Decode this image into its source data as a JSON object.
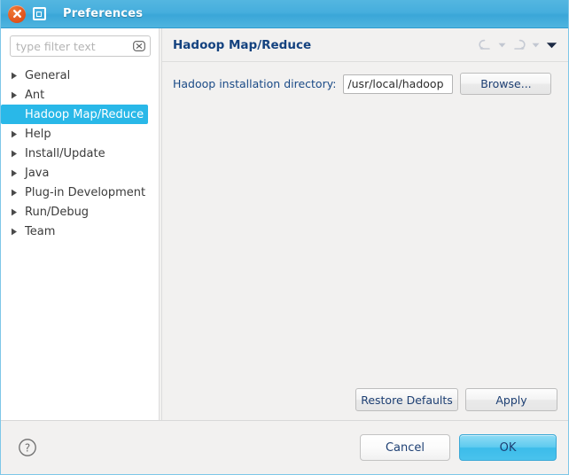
{
  "window": {
    "title": "Preferences",
    "close_icon": "close-icon",
    "maximize_icon": "maximize-icon",
    "titlebar_color": "#46aedd"
  },
  "sidebar": {
    "filter": {
      "placeholder": "type filter text",
      "value": "",
      "clear_icon": "clear-icon"
    },
    "items": [
      {
        "label": "General",
        "expandable": true,
        "selected": false
      },
      {
        "label": "Ant",
        "expandable": true,
        "selected": false
      },
      {
        "label": "Hadoop Map/Reduce",
        "expandable": false,
        "selected": true
      },
      {
        "label": "Help",
        "expandable": true,
        "selected": false
      },
      {
        "label": "Install/Update",
        "expandable": true,
        "selected": false
      },
      {
        "label": "Java",
        "expandable": true,
        "selected": false
      },
      {
        "label": "Plug-in Development",
        "expandable": true,
        "selected": false
      },
      {
        "label": "Run/Debug",
        "expandable": true,
        "selected": false
      },
      {
        "label": "Team",
        "expandable": true,
        "selected": false
      }
    ],
    "selection_color": "#29b8e8"
  },
  "content": {
    "page_title": "Hadoop Map/Reduce",
    "nav": {
      "back_icon": "back-arrow-icon",
      "back_caret_icon": "chevron-down-icon",
      "forward_icon": "forward-arrow-icon",
      "forward_caret_icon": "chevron-down-icon",
      "menu_caret_icon": "chevron-down-icon"
    },
    "form": {
      "install_dir_label": "Hadoop installation directory:",
      "install_dir_value": "/usr/local/hadoop",
      "install_dir_placeholder": "",
      "browse_label": "Browse..."
    },
    "restore_defaults_label": "Restore Defaults",
    "apply_label": "Apply"
  },
  "button_bar": {
    "help_icon": "help-icon",
    "cancel_label": "Cancel",
    "ok_label": "OK",
    "ok_color": "#49c3ed"
  }
}
